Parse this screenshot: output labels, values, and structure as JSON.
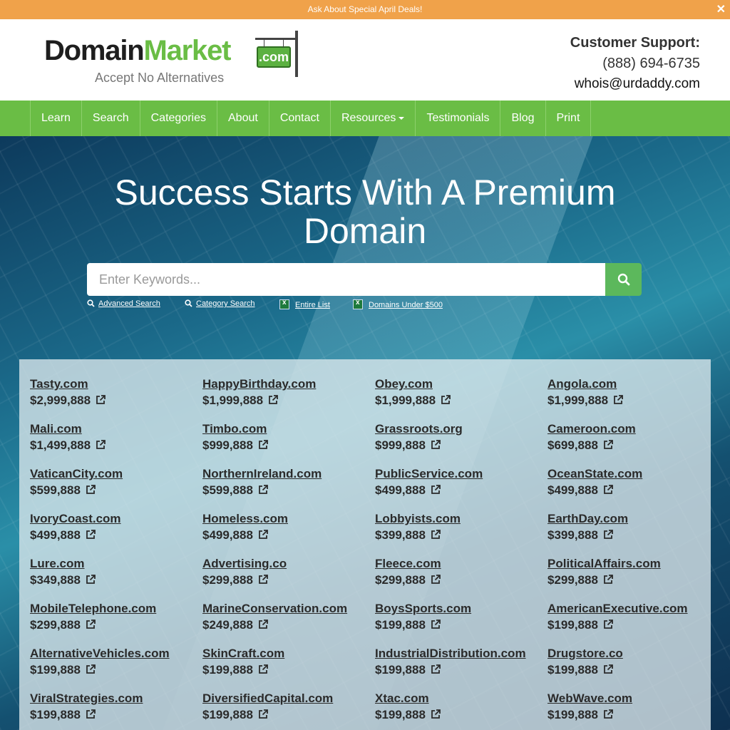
{
  "promo": {
    "text": "Ask About Special April Deals!",
    "close": "✕"
  },
  "header": {
    "logo": {
      "word_dark": "Domain",
      "word_green": "Market",
      "sign": ".com",
      "tagline": "Accept No Alternatives"
    },
    "support": {
      "title": "Customer Support:",
      "phone": "(888) 694-6735",
      "email": "whois@urdaddy.com"
    }
  },
  "nav": {
    "items": [
      "Learn",
      "Search",
      "Categories",
      "About",
      "Contact",
      "Resources",
      "Testimonials",
      "Blog",
      "Print"
    ]
  },
  "hero": {
    "headline_line1": "Success Starts With A Premium",
    "headline_line2": "Domain",
    "search_placeholder": "Enter Keywords...",
    "links": [
      "Advanced Search",
      "Category Search",
      "Entire List",
      "Domains Under $500"
    ]
  },
  "domains": [
    {
      "name": "Tasty.com",
      "price": "$2,999,888"
    },
    {
      "name": "HappyBirthday.com",
      "price": "$1,999,888"
    },
    {
      "name": "Obey.com",
      "price": "$1,999,888"
    },
    {
      "name": "Angola.com",
      "price": "$1,999,888"
    },
    {
      "name": "Mali.com",
      "price": "$1,499,888"
    },
    {
      "name": "Timbo.com",
      "price": "$999,888"
    },
    {
      "name": "Grassroots.org",
      "price": "$999,888"
    },
    {
      "name": "Cameroon.com",
      "price": "$699,888"
    },
    {
      "name": "VaticanCity.com",
      "price": "$599,888"
    },
    {
      "name": "NorthernIreland.com",
      "price": "$599,888"
    },
    {
      "name": "PublicService.com",
      "price": "$499,888"
    },
    {
      "name": "OceanState.com",
      "price": "$499,888"
    },
    {
      "name": "IvoryCoast.com",
      "price": "$499,888"
    },
    {
      "name": "Homeless.com",
      "price": "$499,888"
    },
    {
      "name": "Lobbyists.com",
      "price": "$399,888"
    },
    {
      "name": "EarthDay.com",
      "price": "$399,888"
    },
    {
      "name": "Lure.com",
      "price": "$349,888"
    },
    {
      "name": "Advertising.co",
      "price": "$299,888"
    },
    {
      "name": "Fleece.com",
      "price": "$299,888"
    },
    {
      "name": "PoliticalAffairs.com",
      "price": "$299,888"
    },
    {
      "name": "MobileTelephone.com",
      "price": "$299,888"
    },
    {
      "name": "MarineConservation.com",
      "price": "$249,888"
    },
    {
      "name": "BoysSports.com",
      "price": "$199,888"
    },
    {
      "name": "AmericanExecutive.com",
      "price": "$199,888"
    },
    {
      "name": "AlternativeVehicles.com",
      "price": "$199,888"
    },
    {
      "name": "SkinCraft.com",
      "price": "$199,888"
    },
    {
      "name": "IndustrialDistribution.com",
      "price": "$199,888"
    },
    {
      "name": "Drugstore.co",
      "price": "$199,888"
    },
    {
      "name": "ViralStrategies.com",
      "price": "$199,888"
    },
    {
      "name": "DiversifiedCapital.com",
      "price": "$199,888"
    },
    {
      "name": "Xtac.com",
      "price": "$199,888"
    },
    {
      "name": "WebWave.com",
      "price": "$199,888"
    }
  ],
  "colors": {
    "accent_green": "#6abd45",
    "promo_orange": "#f0a24a",
    "search_button": "#5cb85c"
  },
  "icons": {
    "search_button": "search-icon",
    "external_link": "external-link-icon",
    "excel": "excel-icon"
  }
}
